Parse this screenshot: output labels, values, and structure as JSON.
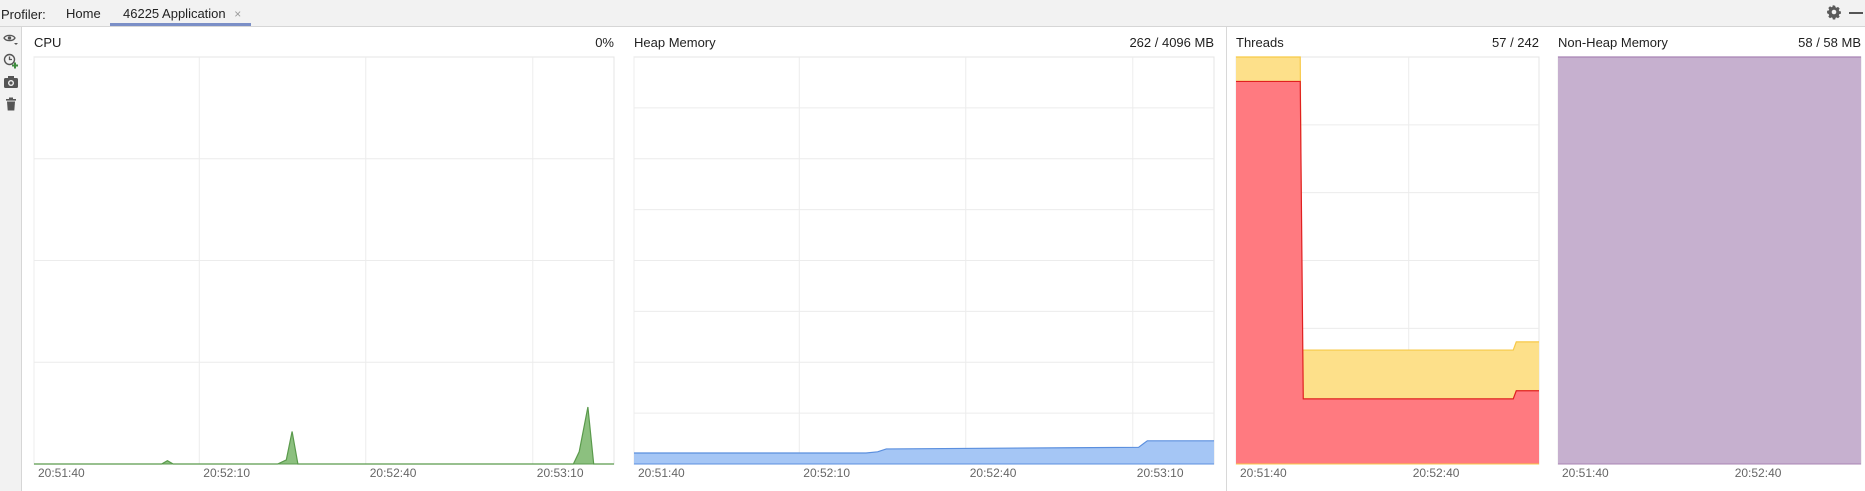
{
  "tabbar": {
    "profiler_label": "Profiler:",
    "tabs": [
      {
        "label": "Home"
      },
      {
        "label": "46225 Application",
        "close": "×"
      }
    ]
  },
  "icons": {
    "left_toolbar": [
      "eye-dropdown-icon",
      "add-process-icon",
      "camera-icon",
      "trash-icon"
    ],
    "top_right": [
      "gear-icon",
      "minimize-icon"
    ]
  },
  "panels": {
    "cpu": {
      "title": "CPU",
      "value": "0%",
      "color": "#5a9a4c",
      "fill": "#8cc07f"
    },
    "heap": {
      "title": "Heap Memory",
      "value": "262 / 4096 MB",
      "color": "#5b8fde",
      "fill": "#a5c6f5"
    },
    "threads": {
      "title": "Threads",
      "value": "57 / 242",
      "color_total": "#f7c948",
      "fill_total": "#fde08a",
      "color_live": "#e02020",
      "fill_live": "#ff7a80"
    },
    "nonheap": {
      "title": "Non-Heap Memory",
      "value": "58 / 58 MB",
      "color": "#a884b3",
      "fill": "#c6b0cf"
    }
  },
  "chart_data": [
    {
      "type": "area",
      "title": "CPU",
      "x_ticks": [
        "20:51:40",
        "20:52:10",
        "20:52:40",
        "20:53:10"
      ],
      "ylim": [
        0,
        100
      ],
      "series": [
        {
          "points": [
            [
              0,
              0
            ],
            [
              22,
              0
            ],
            [
              23,
              0.8
            ],
            [
              24,
              0
            ],
            [
              42,
              0
            ],
            [
              43.5,
              1
            ],
            [
              44.5,
              8
            ],
            [
              45.5,
              0
            ],
            [
              72,
              0
            ],
            [
              93,
              0
            ],
            [
              94,
              3
            ],
            [
              95.5,
              14
            ],
            [
              96.5,
              0
            ],
            [
              100,
              0
            ]
          ]
        }
      ]
    },
    {
      "type": "area",
      "title": "Heap Memory",
      "x_ticks": [
        "20:51:40",
        "20:52:10",
        "20:52:40",
        "20:53:10"
      ],
      "ylim": [
        0,
        100
      ],
      "series": [
        {
          "points": [
            [
              0,
              2.7
            ],
            [
              40,
              2.7
            ],
            [
              42,
              3.0
            ],
            [
              43.5,
              3.7
            ],
            [
              75,
              4.0
            ],
            [
              87,
              4.1
            ],
            [
              88.5,
              5.7
            ],
            [
              100,
              5.7
            ]
          ]
        }
      ]
    },
    {
      "type": "area",
      "title": "Threads",
      "x_ticks": [
        "20:51:40",
        "20:52:40"
      ],
      "ylim": [
        0,
        100
      ],
      "series": [
        {
          "points": [
            [
              0,
              100
            ],
            [
              21.2,
              100
            ],
            [
              21.8,
              28
            ],
            [
              91.5,
              28
            ],
            [
              92.5,
              30
            ],
            [
              100,
              30
            ]
          ]
        },
        {
          "points": [
            [
              0,
              94
            ],
            [
              21.2,
              94
            ],
            [
              22.2,
              16
            ],
            [
              91.5,
              16
            ],
            [
              92.5,
              18
            ],
            [
              100,
              18
            ]
          ]
        }
      ]
    },
    {
      "type": "area",
      "title": "Non-Heap Memory",
      "x_ticks": [
        "20:51:40",
        "20:52:40"
      ],
      "ylim": [
        0,
        100
      ],
      "series": [
        {
          "points": [
            [
              0,
              100
            ],
            [
              100,
              100
            ]
          ]
        }
      ]
    }
  ]
}
